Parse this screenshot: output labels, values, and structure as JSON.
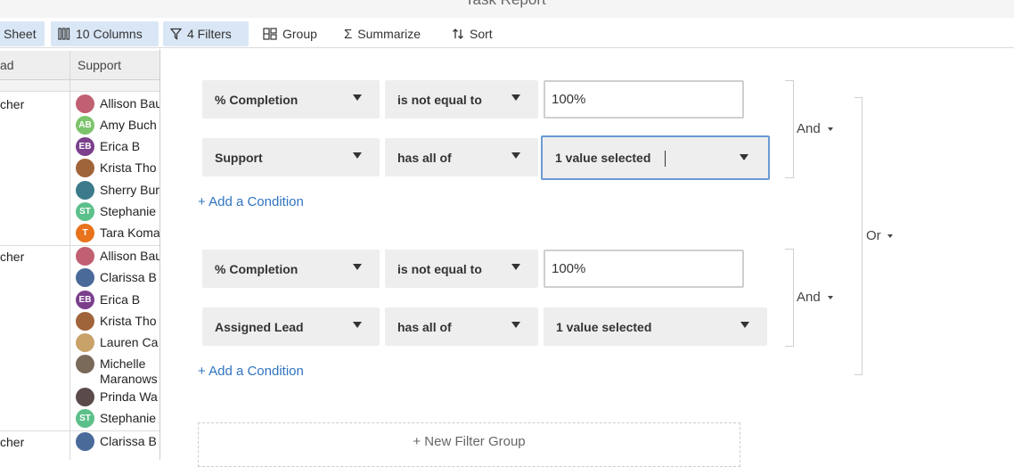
{
  "window": {
    "title": "Task Report"
  },
  "toolbar": {
    "sheet_label": "Sheet",
    "columns_label": "10 Columns",
    "filters_label": "4 Filters",
    "group_label": "Group",
    "summarize_label": "Summarize",
    "sort_label": "Sort"
  },
  "grid": {
    "col_lead_header": "ad",
    "col_support_header": "Support",
    "groups": [
      {
        "lead": "cher",
        "people": [
          {
            "name": "Allison Bau",
            "initials": "",
            "color": "#c06070"
          },
          {
            "name": "Amy Buch",
            "initials": "AB",
            "color": "#7cc46b"
          },
          {
            "name": "Erica B",
            "initials": "EB",
            "color": "#7b3f8c"
          },
          {
            "name": "Krista Tho",
            "initials": "",
            "color": "#a0643a"
          },
          {
            "name": "Sherry Bur",
            "initials": "",
            "color": "#3a7a8a"
          },
          {
            "name": "Stephanie",
            "initials": "ST",
            "color": "#5cc08a"
          },
          {
            "name": "Tara Koma",
            "initials": "T",
            "color": "#e8731c"
          }
        ]
      },
      {
        "lead": "cher",
        "people": [
          {
            "name": "Allison Bau",
            "initials": "",
            "color": "#c06070"
          },
          {
            "name": "Clarissa B",
            "initials": "",
            "color": "#4a6a9a"
          },
          {
            "name": "Erica B",
            "initials": "EB",
            "color": "#7b3f8c"
          },
          {
            "name": "Krista Tho",
            "initials": "",
            "color": "#a0643a"
          },
          {
            "name": "Lauren Ca",
            "initials": "",
            "color": "#c9a26a"
          },
          {
            "name": "Michelle Maranows",
            "initials": "",
            "color": "#7a6a5a"
          },
          {
            "name": "Prinda Wa",
            "initials": "",
            "color": "#5a4a4a"
          },
          {
            "name": "Stephanie",
            "initials": "ST",
            "color": "#5cc08a"
          }
        ]
      },
      {
        "lead": "cher",
        "people": [
          {
            "name": "Clarissa B",
            "initials": "",
            "color": "#4a6a9a"
          }
        ]
      }
    ]
  },
  "filters": {
    "group1": {
      "row1": {
        "field": "% Completion",
        "operator": "is not equal to",
        "value": "100%"
      },
      "row2": {
        "field": "Support",
        "operator": "has all of",
        "value": "1 value selected"
      },
      "add_condition": "+ Add a Condition",
      "logic": "And"
    },
    "group2": {
      "row1": {
        "field": "% Completion",
        "operator": "is not equal to",
        "value": "100%"
      },
      "row2": {
        "field": "Assigned Lead",
        "operator": "has all of",
        "value": "1 value selected"
      },
      "add_condition": "+ Add a Condition",
      "logic": "And"
    },
    "outer_logic": "Or",
    "new_group": "+ New Filter Group"
  },
  "colors": {
    "accent_link": "#2f74c0",
    "focus_border": "#6a9ad4",
    "active_tab_bg": "#d9e6f5"
  }
}
